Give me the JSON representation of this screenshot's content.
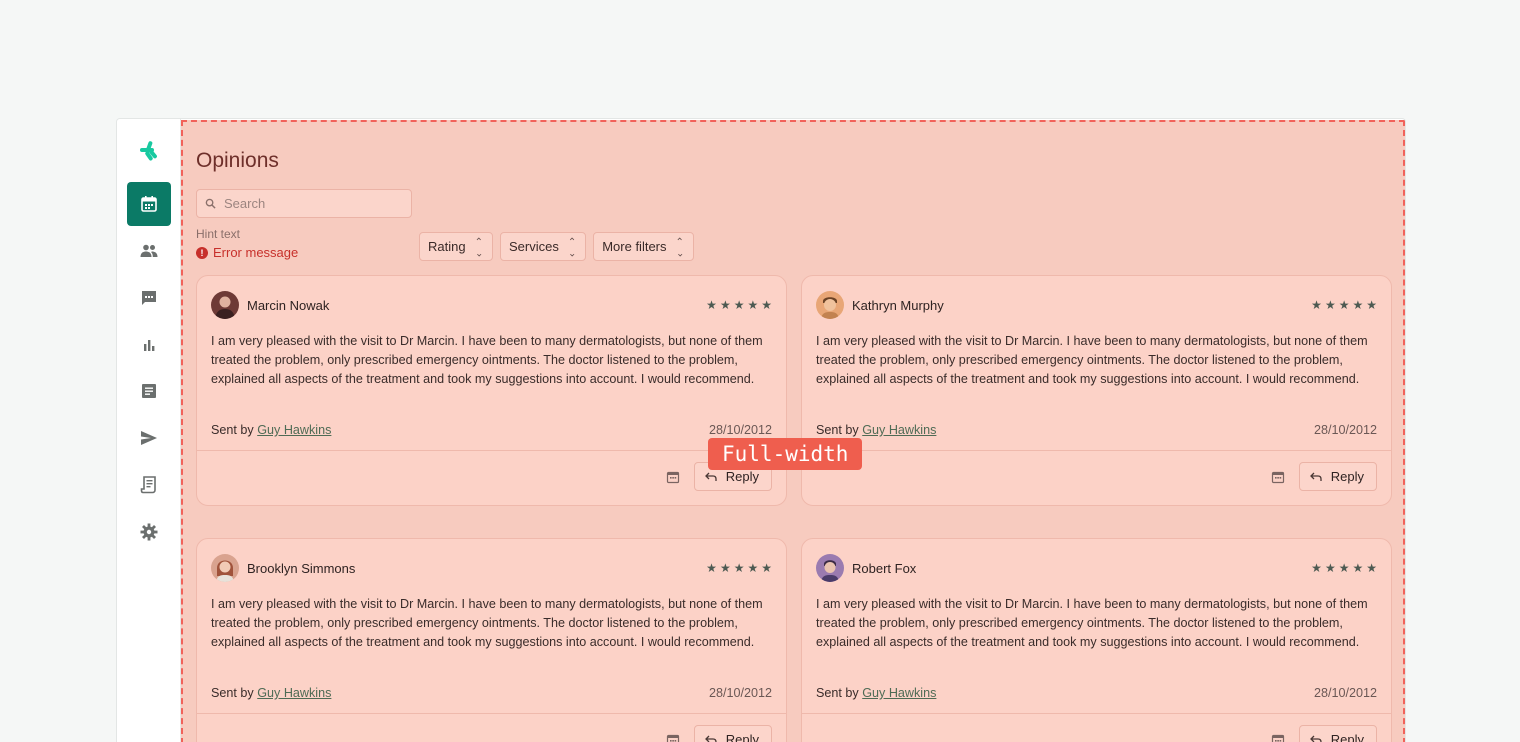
{
  "page": {
    "title": "Opinions"
  },
  "search": {
    "placeholder": "Search",
    "hint": "Hint text",
    "error": "Error message"
  },
  "filters": [
    {
      "label": "Rating"
    },
    {
      "label": "Services"
    },
    {
      "label": "More filters"
    }
  ],
  "reviews": [
    {
      "author": "Marcin Nowak",
      "rating": 5,
      "text": "I am very pleased with the visit to Dr Marcin. I have been to many dermatologists, but none of them treated the problem, only prescribed emergency ointments. The doctor listened to the problem, explained all aspects of the treatment and took my suggestions into account. I would recommend.",
      "sent_by_label": "Sent by",
      "sender": "Guy Hawkins",
      "date": "28/10/2012",
      "reply_label": "Reply"
    },
    {
      "author": "Kathryn Murphy",
      "rating": 5,
      "text": "I am very pleased with the visit to Dr Marcin. I have been to many dermatologists, but none of them treated the problem, only prescribed emergency ointments. The doctor listened to the problem, explained all aspects of the treatment and took my suggestions into account. I would recommend.",
      "sent_by_label": "Sent by",
      "sender": "Guy Hawkins",
      "date": "28/10/2012",
      "reply_label": "Reply"
    },
    {
      "author": "Brooklyn Simmons",
      "rating": 5,
      "text": "I am very pleased with the visit to Dr Marcin. I have been to many dermatologists, but none of them treated the problem, only prescribed emergency ointments. The doctor listened to the problem, explained all aspects of the treatment and took my suggestions into account. I would recommend.",
      "sent_by_label": "Sent by",
      "sender": "Guy Hawkins",
      "date": "28/10/2012",
      "reply_label": "Reply"
    },
    {
      "author": "Robert Fox",
      "rating": 5,
      "text": "I am very pleased with the visit to Dr Marcin. I have been to many dermatologists, but none of them treated the problem, only prescribed emergency ointments. The doctor listened to the problem, explained all aspects of the treatment and took my suggestions into account. I would recommend.",
      "sent_by_label": "Sent by",
      "sender": "Guy Hawkins",
      "date": "28/10/2012",
      "reply_label": "Reply"
    }
  ],
  "sidebar": {
    "items": [
      {
        "icon": "calendar-icon",
        "active": true
      },
      {
        "icon": "people-icon",
        "active": false
      },
      {
        "icon": "chat-icon",
        "active": false
      },
      {
        "icon": "bar-chart-icon",
        "active": false
      },
      {
        "icon": "document-icon",
        "active": false
      },
      {
        "icon": "send-icon",
        "active": false
      },
      {
        "icon": "invoice-icon",
        "active": false
      },
      {
        "icon": "gear-icon",
        "active": false
      }
    ]
  },
  "annotation": {
    "label": "Full-width"
  },
  "colors": {
    "brand": "#0b7a66",
    "overlay": "#f7cbbf",
    "overlay_border": "#f1625a",
    "error": "#c7302b",
    "star": "#4d5a52"
  }
}
